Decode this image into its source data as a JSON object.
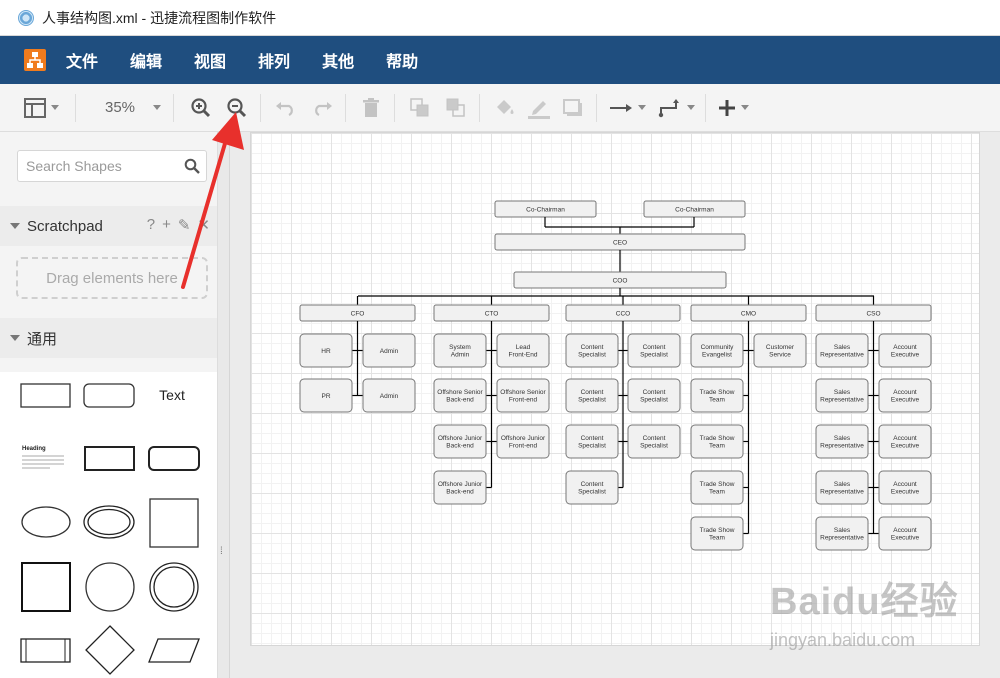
{
  "window": {
    "title": "人事结构图.xml - 迅捷流程图制作软件"
  },
  "menu": {
    "items": [
      "文件",
      "编辑",
      "视图",
      "排列",
      "其他",
      "帮助"
    ]
  },
  "toolbar": {
    "zoom": "35%"
  },
  "sidebar": {
    "search_placeholder": "Search Shapes",
    "scratchpad": {
      "title": "Scratchpad",
      "tools": [
        "?",
        "+",
        "✎",
        "✕"
      ],
      "drop_hint": "Drag elements here"
    },
    "general": {
      "title": "通用"
    },
    "shapes": {
      "text_label": "Text",
      "heading_label": "Heading"
    }
  },
  "diagram": {
    "chairs": [
      "Co-Chairman",
      "Co-Chairman"
    ],
    "ceo": "CEO",
    "coo": "COO",
    "departments": [
      {
        "title": "CFO",
        "left": [
          "HR",
          "PR"
        ],
        "right": [
          "Admin",
          "Admin"
        ]
      },
      {
        "title": "CTO",
        "left": [
          "System Admin",
          "Offshore Senior Back-end",
          "Offshore Junior Back-end",
          "Offshore Junior Back-end"
        ],
        "right": [
          "Lead Front-End",
          "Offshore Senior Front-end",
          "Offshore Junior Front-end"
        ]
      },
      {
        "title": "CCO",
        "left": [
          "Content Specialist",
          "Content Specialist",
          "Content Specialist",
          "Content Specialist"
        ],
        "right": [
          "Content Specialist",
          "Content Specialist",
          "Content Specialist"
        ]
      },
      {
        "title": "CMO",
        "left": [
          "Community Evangelist",
          "Trade Show Team",
          "Trade Show Team",
          "Trade Show Team",
          "Trade Show Team"
        ],
        "right": [
          "Customer Service"
        ]
      },
      {
        "title": "CSO",
        "left": [
          "Sales Representative",
          "Sales Representative",
          "Sales Representative",
          "Sales Representative",
          "Sales Representative"
        ],
        "right": [
          "Account Executive",
          "Account Executive",
          "Account Executive",
          "Account Executive",
          "Account Executive"
        ]
      }
    ]
  },
  "watermark": {
    "main": "Baidu经验",
    "sub": "jingyan.baidu.com"
  },
  "colors": {
    "menubar": "#1f4e7f",
    "logo": "#f07b1d",
    "annotation": "#e8302c"
  }
}
